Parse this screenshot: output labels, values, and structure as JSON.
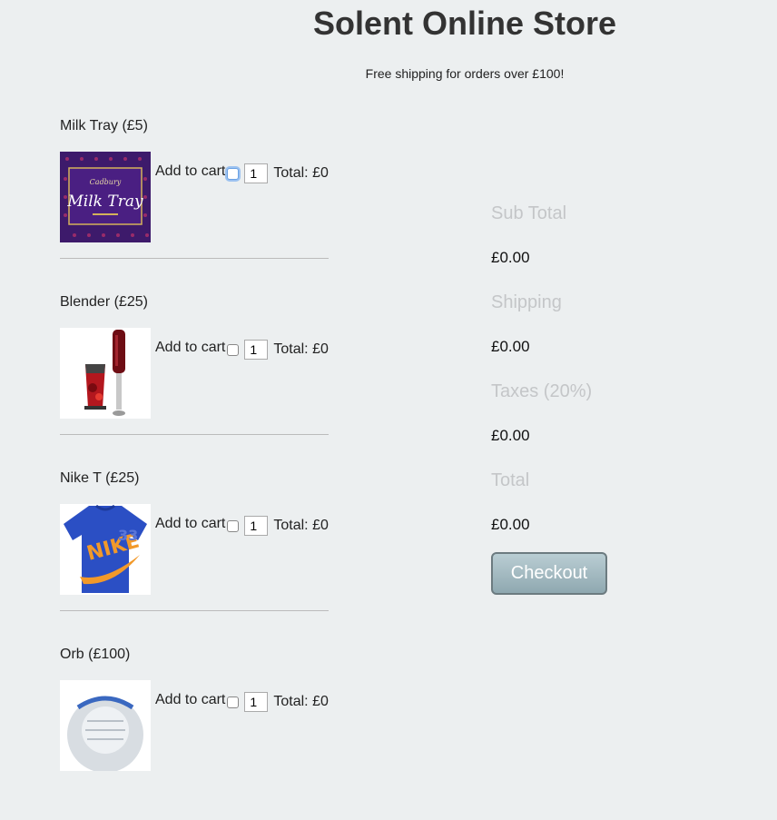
{
  "header": {
    "title": "Solent Online Store",
    "subtitle": "Free shipping for orders over £100!"
  },
  "products": [
    {
      "name": "Milk Tray (£5)",
      "add_label": "Add to cart",
      "quantity": "1",
      "total": "Total: £0",
      "checked": false,
      "image": "milk-tray-box"
    },
    {
      "name": "Blender (£25)",
      "add_label": "Add to cart",
      "quantity": "1",
      "total": "Total: £0",
      "checked": false,
      "image": "hand-blender"
    },
    {
      "name": "Nike T (£25)",
      "add_label": "Add to cart",
      "quantity": "1",
      "total": "Total: £0",
      "checked": false,
      "image": "nike-tshirt"
    },
    {
      "name": "Orb (£100)",
      "add_label": "Add to cart",
      "quantity": "1",
      "total": "Total: £0",
      "checked": false,
      "image": "orb-device"
    }
  ],
  "summary": {
    "subtotal_label": "Sub Total",
    "subtotal_value": "£0.00",
    "shipping_label": "Shipping",
    "shipping_value": "£0.00",
    "taxes_label": "Taxes (20%)",
    "taxes_value": "£0.00",
    "total_label": "Total",
    "total_value": "£0.00",
    "checkout_label": "Checkout"
  },
  "colors": {
    "background": "#eceff0",
    "summary_label": "#c4c6c8",
    "checkout_button": "#a3bac1",
    "focus_ring": "#6aa1e4"
  }
}
